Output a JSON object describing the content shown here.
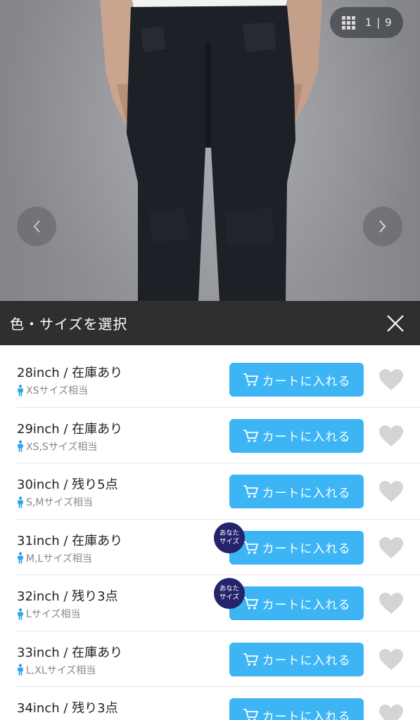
{
  "gallery": {
    "counter": "1 | 9"
  },
  "select_bar": {
    "title": "色・サイズを選択"
  },
  "cart_label": "カートに入れる",
  "your_size_badge": {
    "line1": "あなた",
    "line2": "サイズ"
  },
  "sizes": [
    {
      "name": "28inch / 在庫あり",
      "fit": "XSサイズ相当",
      "your_size": false
    },
    {
      "name": "29inch / 在庫あり",
      "fit": "XS,Sサイズ相当",
      "your_size": false
    },
    {
      "name": "30inch / 残り5点",
      "fit": "S,Mサイズ相当",
      "your_size": false
    },
    {
      "name": "31inch / 在庫あり",
      "fit": "M,Lサイズ相当",
      "your_size": true
    },
    {
      "name": "32inch / 残り3点",
      "fit": "Lサイズ相当",
      "your_size": true
    },
    {
      "name": "33inch / 在庫あり",
      "fit": "L,XLサイズ相当",
      "your_size": false
    },
    {
      "name": "34inch / 残り3点",
      "fit": "",
      "your_size": false
    }
  ],
  "colors": {
    "cart_button": "#3db5f4",
    "select_bar": "#2f2f2f",
    "badge": "#23246b",
    "heart": "#d4d4d4",
    "person_icon": "#2aa7e8"
  },
  "icons": {
    "gallery": "grid-icon",
    "prev": "chevron-left-icon",
    "next": "chevron-right-icon",
    "close": "close-icon",
    "cart": "cart-icon",
    "favorite": "heart-icon",
    "fit": "person-icon"
  }
}
